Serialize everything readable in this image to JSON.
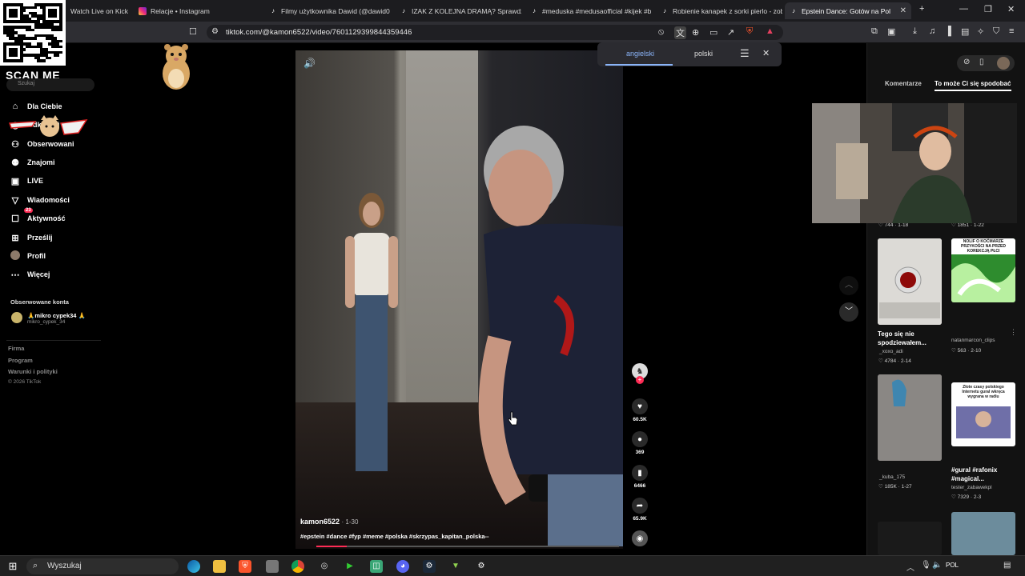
{
  "browser": {
    "tabs": [
      {
        "title": "Watch Live on Kick",
        "fav": "kick-icon",
        "color": "#53fc18"
      },
      {
        "title": "Relacje • Instagram",
        "fav": "instagram-icon",
        "color": "#e1306c"
      },
      {
        "title": "Filmy użytkownika Dawid (@dawid0",
        "fav": "tiktok-icon",
        "color": "#000000"
      },
      {
        "title": "IZAK Z KOLEJNA DRAMĄ? Sprawdź",
        "fav": "tiktok-icon",
        "color": "#000000"
      },
      {
        "title": "#meduska #medusaofficial #kijek #b",
        "fav": "tiktok-icon",
        "color": "#000000"
      },
      {
        "title": "Robienie kanapek z sorki pierlo - zob",
        "fav": "tiktok-icon",
        "color": "#000000"
      },
      {
        "title": "Epstein Dance: Gotów na Pol",
        "fav": "tiktok-icon",
        "color": "#000000"
      }
    ],
    "url": "tiktok.com/@kamon6522/video/7601129399844359446"
  },
  "overlay": {
    "scan_label": "SCAN ME"
  },
  "sidebar": {
    "search_placeholder": "Szukaj",
    "items": [
      {
        "label": "Dla Ciebie",
        "icon": "home-icon"
      },
      {
        "label": "Odkrywaj",
        "icon": "compass-icon"
      },
      {
        "label": "Obserwowani",
        "icon": "user-follow-icon"
      },
      {
        "label": "Znajomi",
        "icon": "friends-icon"
      },
      {
        "label": "LIVE",
        "icon": "live-icon"
      },
      {
        "label": "Wiadomości",
        "icon": "send-icon"
      },
      {
        "label": "Aktywność",
        "icon": "inbox-icon",
        "badge": "23"
      },
      {
        "label": "Prześlij",
        "icon": "plus-square-icon"
      },
      {
        "label": "Profil",
        "icon": "avatar"
      },
      {
        "label": "Więcej",
        "icon": "more-icon"
      }
    ],
    "followed_heading": "Obserwowane konta",
    "followed": [
      {
        "name": "🙏mikro cypek34 🙏",
        "handle": "mikro_cypek_34"
      }
    ],
    "footer": [
      "Firma",
      "Program",
      "Warunki i polityki"
    ],
    "copyright": "© 2026 TikTok"
  },
  "translate_popup": {
    "lang_a": "angielski",
    "lang_b": "polski"
  },
  "video": {
    "user": "kamon6522",
    "time": "· 1-30",
    "tags": "#epstein #dance #fyp #meme #polska #skrzypas_kapitan_polska--",
    "progress": 0.1,
    "actions": [
      {
        "name": "like",
        "icon": "heart-icon",
        "count": "60.5K"
      },
      {
        "name": "comment",
        "icon": "comment-icon",
        "count": "369"
      },
      {
        "name": "save",
        "icon": "bookmark-icon",
        "count": "6466"
      },
      {
        "name": "share",
        "icon": "share-icon",
        "count": "65.9K"
      }
    ]
  },
  "right_panel": {
    "tab_comments": "Komentarze",
    "tab_suggested": "To może Ci się spodobać",
    "videos": [
      {
        "meta": "♡ 744 · 1-18",
        "title": "",
        "user": ""
      },
      {
        "meta": "♡ 1851 · 1-22",
        "title": "",
        "user": ""
      },
      {
        "meta": "♡ 4784 · 2-14",
        "title": "Tego się nie spodziewałem...",
        "user": "_xoxo_adi"
      },
      {
        "meta": "♡ 563 · 2-10",
        "title": "",
        "user": "natanmarcon_clips"
      },
      {
        "meta": "♡ 185K · 1-27",
        "title": "",
        "user": "_kuba_175"
      },
      {
        "meta": "♡ 7329 · 2-3",
        "title": "#gural #rafonix #magical...",
        "user": "tester_zabawekpl"
      }
    ],
    "thumb_caption_1": "NOLIF O KOĆMARZE PRZYKOŚCI NA PRZED KOREKCJĄ PŁCI",
    "thumb_caption_2": "Złote czasy polskiego Internetu gural wkręca wygrana w radiu"
  },
  "taskbar": {
    "search_placeholder": "Wyszukaj",
    "lang": "POL"
  },
  "colors": {
    "accent": "#fe2c55",
    "link": "#8ab4f8"
  }
}
